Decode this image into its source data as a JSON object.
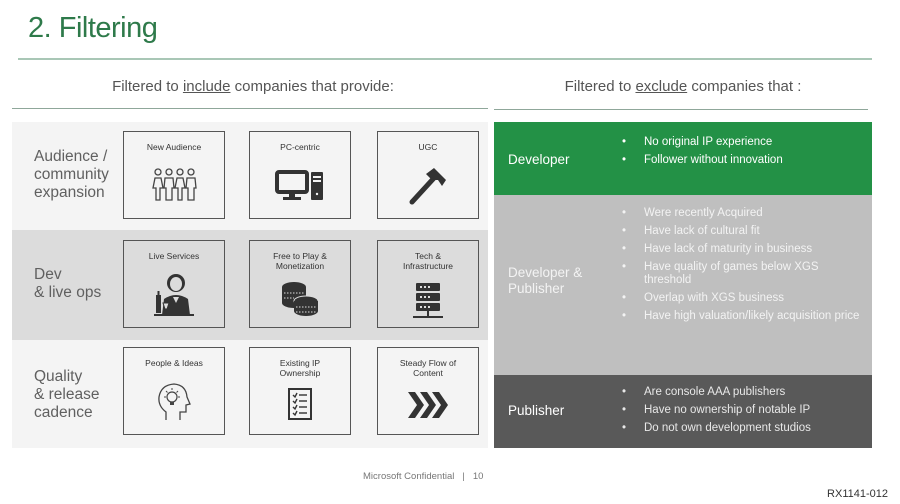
{
  "slide": {
    "title": "2. Filtering"
  },
  "include": {
    "header_prefix": "Filtered to ",
    "header_keyword": "include",
    "header_suffix": " companies that provide:",
    "rows": [
      {
        "label": "Audience /\ncommunity\nexpansion",
        "tiles": [
          {
            "caption": "New Audience",
            "icon": "people-group-icon"
          },
          {
            "caption": "PC-centric",
            "icon": "desktop-computer-icon"
          },
          {
            "caption": "UGC",
            "icon": "hammer-icon"
          }
        ]
      },
      {
        "label": "Dev\n& live ops",
        "tiles": [
          {
            "caption": "Live Services",
            "icon": "waiter-icon"
          },
          {
            "caption": "Free to Play &\nMonetization",
            "icon": "coins-icon"
          },
          {
            "caption": "Tech &\nInfrastructure",
            "icon": "server-icon"
          }
        ]
      },
      {
        "label": "Quality\n& release\ncadence",
        "tiles": [
          {
            "caption": "People & Ideas",
            "icon": "head-lightbulb-icon"
          },
          {
            "caption": "Existing IP\nOwnership",
            "icon": "checklist-icon"
          },
          {
            "caption": "Steady Flow of\nContent",
            "icon": "triple-chevron-icon"
          }
        ]
      }
    ]
  },
  "exclude": {
    "header_prefix": "Filtered to ",
    "header_keyword": "exclude",
    "header_suffix": " companies that :",
    "groups": [
      {
        "label": "Developer",
        "color": "#239146",
        "items": [
          "No original IP experience",
          "Follower without innovation"
        ]
      },
      {
        "label": "Developer &\nPublisher",
        "color": "#bfbfbf",
        "items": [
          "Were recently Acquired",
          "Have lack of cultural fit",
          "Have lack of maturity in business",
          "Have quality of games below XGS threshold",
          "Overlap with XGS business",
          "Have high valuation/likely acquisition price"
        ]
      },
      {
        "label": "Publisher",
        "color": "#595959",
        "items": [
          "Are console AAA publishers",
          "Have no ownership of notable IP",
          "Do not own development studios"
        ]
      }
    ]
  },
  "footer": {
    "confidential": "Microsoft Confidential",
    "separator": "|",
    "page_number": "10",
    "exhibit_id": "RX1141-012"
  },
  "colors": {
    "accent_green": "#239146",
    "title_green": "#2e7a4a",
    "mid_gray": "#bfbfbf",
    "dark_gray": "#595959"
  }
}
